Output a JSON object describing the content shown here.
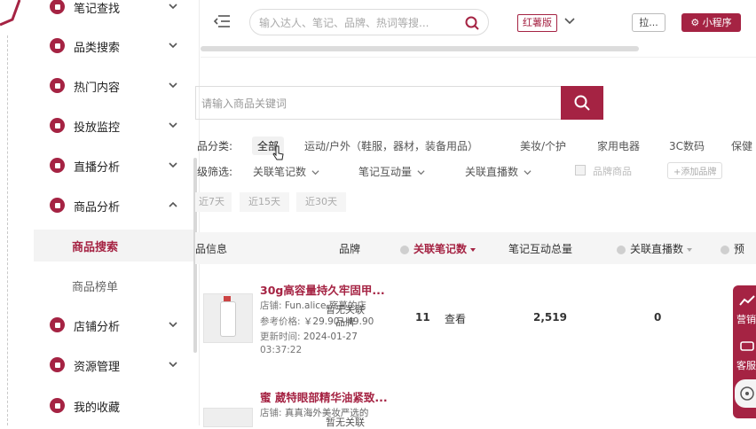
{
  "sidebar": {
    "items": [
      {
        "label": "笔记查找"
      },
      {
        "label": "品类搜索"
      },
      {
        "label": "热门内容"
      },
      {
        "label": "投放监控"
      },
      {
        "label": "直播分析"
      },
      {
        "label": "商品分析"
      },
      {
        "label": "店铺分析"
      },
      {
        "label": "资源管理"
      },
      {
        "label": "我的收藏"
      }
    ],
    "sub_items": [
      {
        "label": "商品搜索",
        "active": true
      },
      {
        "label": "商品榜单",
        "active": false
      }
    ]
  },
  "topbar": {
    "search_placeholder": "输入达人、笔记、品牌、热词等搜...",
    "edition": "红薯版",
    "login": "拉...",
    "mini_program": "小程序"
  },
  "product_search": {
    "placeholder": "请输入商品关键词"
  },
  "categories": {
    "label": "品分类:",
    "items": [
      "全部",
      "运动/户外（鞋服，器材，装备用品）",
      "美妆/个护",
      "家用电器",
      "3C数码",
      "保健"
    ],
    "active": "全部"
  },
  "filters": {
    "label": "级筛选:",
    "items": [
      "关联笔记数",
      "笔记互动量",
      "关联直播数"
    ],
    "brand_checkbox": "品牌商品",
    "add_brand": "+添加品牌"
  },
  "periods": [
    "近7天",
    "近15天",
    "近30天"
  ],
  "table": {
    "headers": [
      "品信息",
      "品牌",
      "关联笔记数",
      "笔记互动总量",
      "关联直播数",
      "预"
    ],
    "rows": [
      {
        "title": "30g高容量持久牢固甲...",
        "shop_label": "店铺:",
        "shop": "Fun.alice.殇蔓的店",
        "price_label": "参考价格:",
        "price": "￥29.90~49.90",
        "updated_label": "更新时间:",
        "updated": "2024-01-27",
        "updated_time": "03:37:22",
        "brand": "暂无关联品牌",
        "notes": "11",
        "view": "查看",
        "interactions": "2,519",
        "lives": "0"
      },
      {
        "title": "蜜 葳特眼部精华油紧致...",
        "shop_label": "店铺:",
        "shop": "真真海外美妆严选的",
        "brand": "暂无关联"
      }
    ]
  },
  "float": {
    "items": [
      "营销",
      "客服"
    ]
  },
  "colors": {
    "brand": "#a52343"
  }
}
